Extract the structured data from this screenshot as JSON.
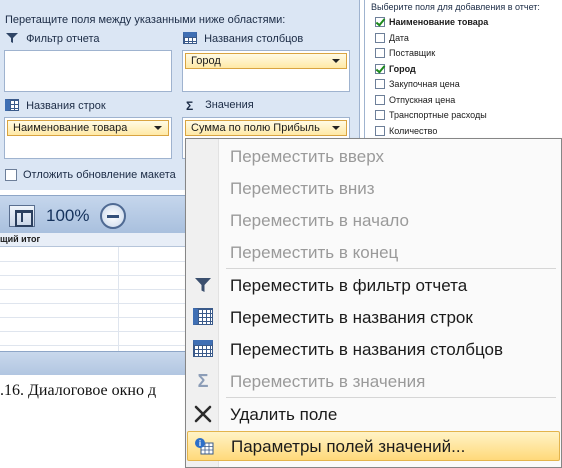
{
  "pivot_pane": {
    "caption": "Перетащите поля между указанными ниже областями:",
    "filter_label": "Фильтр отчета",
    "columns_label": "Названия столбцов",
    "rows_label": "Названия строк",
    "values_label": "Значения",
    "columns_field": "Город",
    "rows_field": "Наименование товара",
    "values_field": "Сумма по полю Прибыль",
    "defer_update_label": "Отложить обновление макета"
  },
  "field_chooser": {
    "caption": "Выберите поля для добавления в отчет:",
    "fields": [
      {
        "label": "Наименование товара",
        "checked": true
      },
      {
        "label": "Дата",
        "checked": false
      },
      {
        "label": "Поставщик",
        "checked": false
      },
      {
        "label": "Город",
        "checked": true
      },
      {
        "label": "Закупочная цена",
        "checked": false
      },
      {
        "label": "Отпускная цена",
        "checked": false
      },
      {
        "label": "Транспортные расходы",
        "checked": false
      },
      {
        "label": "Количество",
        "checked": false
      }
    ]
  },
  "status_bar": {
    "zoom": "100%"
  },
  "sheet": {
    "grand_total_header": "щий итог"
  },
  "caption": ".16. Диалоговое окно д",
  "context_menu": {
    "items": [
      {
        "label": "Переместить вверх",
        "enabled": false,
        "icon": ""
      },
      {
        "label": "Переместить вниз",
        "enabled": false,
        "icon": ""
      },
      {
        "label": "Переместить в начало",
        "enabled": false,
        "icon": ""
      },
      {
        "label": "Переместить в конец",
        "enabled": false,
        "icon": ""
      },
      {
        "label": "Переместить в фильтр отчета",
        "enabled": true,
        "icon": "filter-icon"
      },
      {
        "label": "Переместить в названия строк",
        "enabled": true,
        "icon": "row-labels-icon"
      },
      {
        "label": "Переместить в названия столбцов",
        "enabled": true,
        "icon": "column-labels-icon"
      },
      {
        "label": "Переместить в значения",
        "enabled": false,
        "icon": "sigma-icon"
      },
      {
        "label": "Удалить поле",
        "enabled": true,
        "icon": "delete-x-icon"
      },
      {
        "label": "Параметры полей значений...",
        "enabled": true,
        "icon": "field-settings-icon",
        "highlighted": true
      }
    ]
  },
  "colors": {
    "pane_bg": "#dbe6f4",
    "menu_highlight": "#ffd97a",
    "disabled_text": "#9a9a9a"
  }
}
